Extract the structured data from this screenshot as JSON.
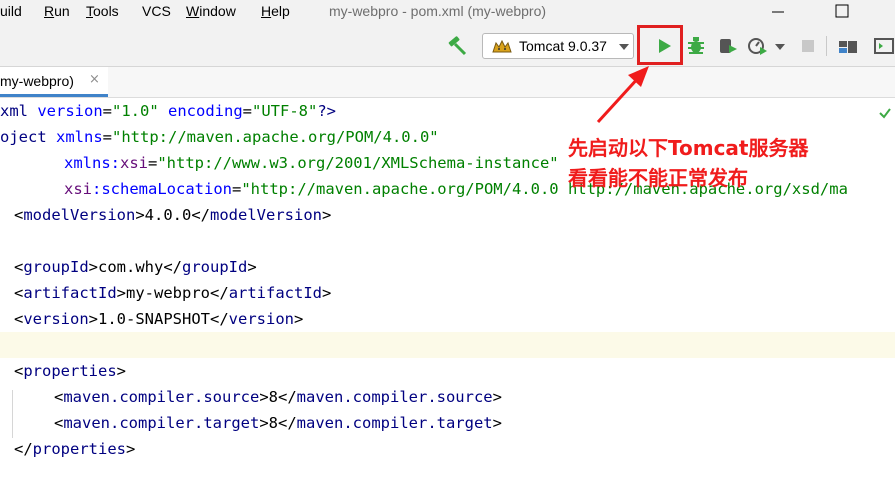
{
  "menu": {
    "items": [
      {
        "label": "Build",
        "visible": "uild"
      },
      {
        "pre": "",
        "u": "R",
        "post": "un"
      },
      {
        "pre": "",
        "u": "T",
        "post": "ools"
      },
      {
        "pre": "VCS",
        "u": "",
        "post": ""
      },
      {
        "pre": "",
        "u": "W",
        "post": "indow"
      },
      {
        "pre": "",
        "u": "H",
        "post": "elp"
      }
    ]
  },
  "window": {
    "title": "my-webpro - pom.xml (my-webpro)"
  },
  "toolbar": {
    "run_config": "Tomcat 9.0.37"
  },
  "tab": {
    "label": "my-webpro)",
    "close": "×"
  },
  "annotation": {
    "line1": "先启动以下Tomcat服务器",
    "line2": "看看能不能正常发布"
  },
  "colors": {
    "accent": "#e02020",
    "run_green": "#3daa45"
  },
  "code": {
    "l1": {
      "a": "xml ",
      "b": "version",
      "c": "=",
      "d": "\"1.0\"",
      "e": " ",
      "f": "encoding",
      "g": "=",
      "h": "\"UTF-8\"",
      "i": "?>"
    },
    "l2": {
      "a": "oject ",
      "b": "xmlns",
      "c": "=",
      "d": "\"http://maven.apache.org/POM/4.0.0\""
    },
    "l3": {
      "a": "xmlns:",
      "b": "xsi",
      "c": "=",
      "d": "\"http://www.w3.org/2001/XMLSchema-instance\""
    },
    "l4": {
      "a": "xsi",
      "b": ":schemaLocation",
      "c": "=",
      "d": "\"http://maven.apache.org/POM/4.0.0 http://maven.apache.org/xsd/ma"
    },
    "l5": {
      "o": "<",
      "t": "modelVersion",
      "c": ">",
      "v": "4.0.0",
      "co": "</",
      "ct": "modelVersion",
      "cc": ">"
    },
    "l7": {
      "o": "<",
      "t": "groupId",
      "c": ">",
      "v": "com.why",
      "co": "</",
      "ct": "groupId",
      "cc": ">"
    },
    "l8": {
      "o": "<",
      "t": "artifactId",
      "c": ">",
      "v": "my-webpro",
      "co": "</",
      "ct": "artifactId",
      "cc": ">"
    },
    "l9": {
      "o": "<",
      "t": "version",
      "c": ">",
      "v": "1.0-SNAPSHOT",
      "co": "</",
      "ct": "version",
      "cc": ">"
    },
    "l11": {
      "o": "<",
      "t": "properties",
      "c": ">"
    },
    "l12": {
      "o": "<",
      "t": "maven.compiler.source",
      "c": ">",
      "v": "8",
      "co": "</",
      "ct": "maven.compiler.source",
      "cc": ">"
    },
    "l13": {
      "o": "<",
      "t": "maven.compiler.target",
      "c": ">",
      "v": "8",
      "co": "</",
      "ct": "maven.compiler.target",
      "cc": ">"
    },
    "l14": {
      "o": "</",
      "t": "properties",
      "c": ">"
    }
  }
}
